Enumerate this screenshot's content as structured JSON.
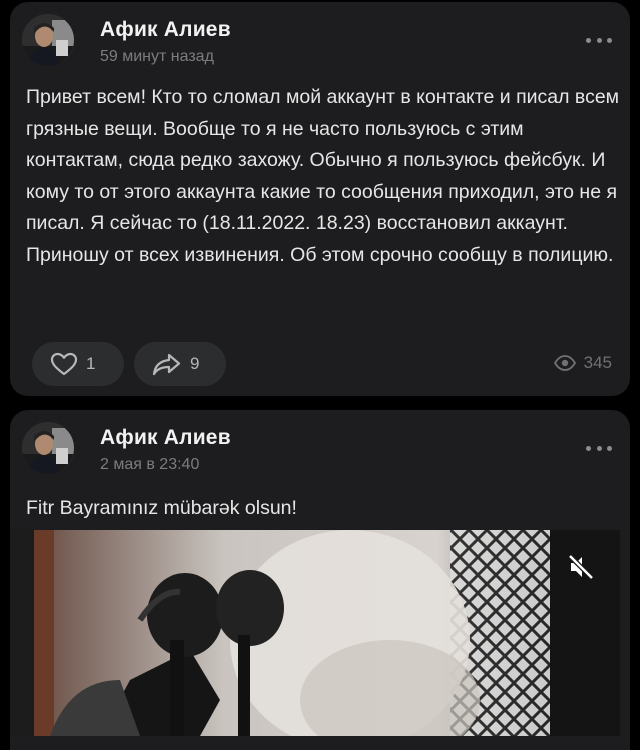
{
  "posts": [
    {
      "author": "Афик Алиев",
      "time": "59 минут назад",
      "text": "Привет всем! Кто то сломал мой аккаунт в контакте и писал всем грязные вещи. Вообще то я не часто пользуюсь с этим контактам, сюда редко захожу. Обычно я пользуюсь фейсбук. И кому то от этого аккаунта какие то сообщения приходил, это не я писал. Я сейчас то (18.11.2022. 18.23) восстановил аккаунт. Приношу от всех извинения. Об этом срочно сообщу в полицию.",
      "likes": "1",
      "shares": "9",
      "views": "345"
    },
    {
      "author": "Афик Алиев",
      "time": "2 мая в 23:40",
      "text": "Fitr Bayramınız mübarək olsun!"
    }
  ],
  "icons": {
    "more": "more-horizontal-icon",
    "like": "heart-icon",
    "share": "share-arrow-icon",
    "views": "eye-icon",
    "mute": "volume-muted-icon"
  },
  "colors": {
    "background": "#000000",
    "card": "#1d1d1f",
    "text": "#e6e6e6",
    "secondary": "#7a7c80",
    "pill": "#2c2d2f"
  }
}
